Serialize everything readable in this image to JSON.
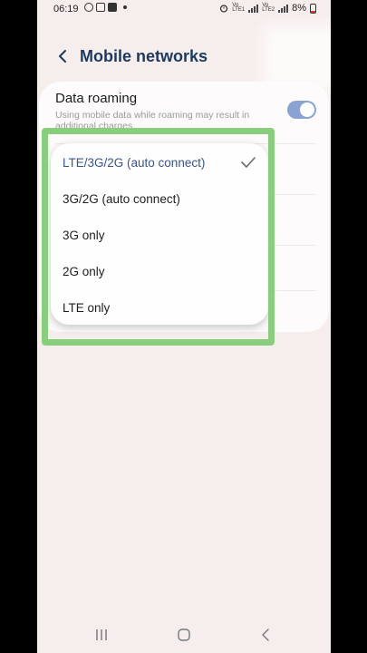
{
  "status_bar": {
    "time": "06:19",
    "battery": "8%",
    "network_tag": "VoLTE LTE1"
  },
  "header": {
    "title": "Mobile networks",
    "back_icon": "chevron-left-icon"
  },
  "data_roaming": {
    "title": "Data roaming",
    "description": "Using mobile data while roaming may result in additional charges.",
    "enabled": true
  },
  "network_mode_dropdown": {
    "selected": "LTE/3G/2G (auto connect)",
    "options": [
      {
        "label": "LTE/3G/2G (auto connect)",
        "selected": true
      },
      {
        "label": "3G/2G (auto connect)",
        "selected": false
      },
      {
        "label": "3G only",
        "selected": false
      },
      {
        "label": "2G only",
        "selected": false
      },
      {
        "label": "LTE only",
        "selected": false
      }
    ]
  },
  "nav_bar": {
    "recents_icon": "recents-icon",
    "home_icon": "home-icon",
    "back_icon": "back-icon"
  },
  "colors": {
    "accent": "#3a5587",
    "toggle_on": "#8aa3d2",
    "highlight": "#88ce7c",
    "background": "#f6eeec"
  }
}
